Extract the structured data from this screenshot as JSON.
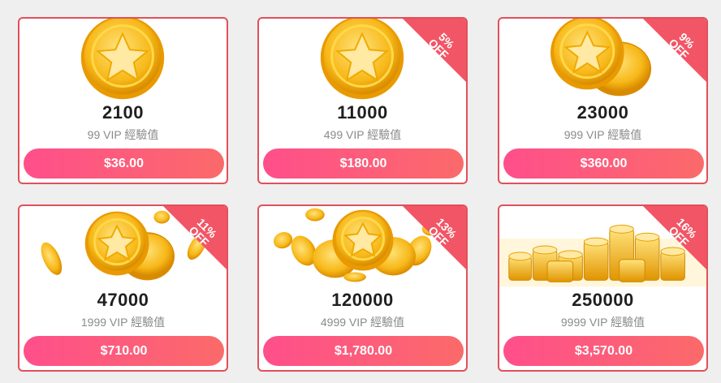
{
  "colors": {
    "card_border": "#e2505a",
    "button_gradient_start": "#ff4f8b",
    "button_gradient_end": "#fb6a6a",
    "ribbon": "#f25565",
    "coin_gold": "#f7b818"
  },
  "packages": [
    {
      "coins": "2100",
      "vip": "99 VIP 經驗值",
      "price": "$36.00",
      "discount": "",
      "off": "",
      "icon": "single-star-coin-icon"
    },
    {
      "coins": "11000",
      "vip": "499 VIP 經驗值",
      "price": "$180.00",
      "discount": "5%",
      "off": "OFF",
      "icon": "single-star-coin-icon"
    },
    {
      "coins": "23000",
      "vip": "999 VIP 經驗值",
      "price": "$360.00",
      "discount": "9%",
      "off": "OFF",
      "icon": "two-star-coins-icon"
    },
    {
      "coins": "47000",
      "vip": "1999 VIP 經驗值",
      "price": "$710.00",
      "discount": "11%",
      "off": "OFF",
      "icon": "scattered-coins-icon"
    },
    {
      "coins": "120000",
      "vip": "4999 VIP 經驗值",
      "price": "$1,780.00",
      "discount": "13%",
      "off": "OFF",
      "icon": "coin-burst-icon"
    },
    {
      "coins": "250000",
      "vip": "9999 VIP 經驗值",
      "price": "$3,570.00",
      "discount": "16%",
      "off": "OFF",
      "icon": "coin-stacks-icon"
    }
  ]
}
